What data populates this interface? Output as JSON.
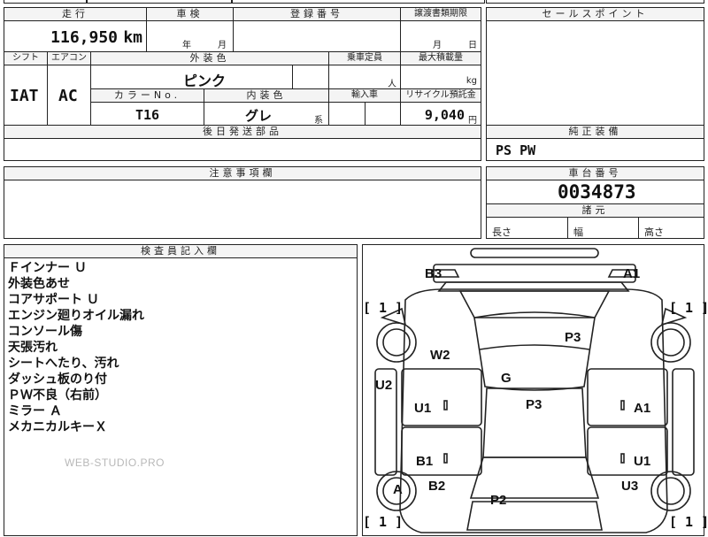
{
  "top_row": {
    "mileage_header": "走行",
    "mileage_value": "116,950",
    "mileage_unit": "km",
    "inspection_header": "車検",
    "inspection_year_label": "年",
    "inspection_month_label": "月",
    "registration_header": "登録番号",
    "transfer_header": "譲渡書類期限",
    "transfer_month_label": "月",
    "transfer_day_label": "日",
    "sales_point_header": "セールスポイント"
  },
  "mid_block": {
    "shift_header": "シフト",
    "shift_value": "IAT",
    "ac_header": "エアコン",
    "ac_value": "AC",
    "exterior_color_header": "外装色",
    "exterior_color_value": "ピンク",
    "capacity_header": "乗車定員",
    "capacity_unit": "人",
    "max_load_header": "最大積載量",
    "max_load_unit": "kg",
    "color_no_header": "カラーNo.",
    "color_no_value": "T16",
    "interior_color_header": "内装色",
    "interior_color_value": "グレ",
    "interior_color_suffix": "系",
    "import_header": "輸入車",
    "recycle_header": "リサイクル預託金",
    "recycle_value": "9,040",
    "recycle_unit": "円",
    "later_parts_header": "後日発送部品"
  },
  "equipment": {
    "header": "純正装備",
    "value": "PS PW"
  },
  "caution": {
    "header": "注意事項欄"
  },
  "chassis": {
    "header": "車台番号",
    "value": "0034873",
    "dims_header": "諸元",
    "length_label": "長さ",
    "width_label": "幅",
    "height_label": "高さ"
  },
  "inspector": {
    "header": "検査員記入欄",
    "notes": [
      "Ｆインナー Ｕ",
      "外装色あせ",
      "コアサポート Ｕ",
      "エンジン廻りオイル漏れ",
      "コンソール傷",
      "天張汚れ",
      "シートへたり、汚れ",
      "ダッシュ板のり付",
      "ＰＷ不良（右前）",
      "ミラー Ａ",
      "メカニカルキーＸ"
    ],
    "watermark": "WEB-STUDIO.PRO"
  },
  "diagram": {
    "labels": {
      "b3": "B3",
      "a1_top": "A1",
      "p3_top": "P3",
      "w2": "W2",
      "u2": "U2",
      "g": "G",
      "u1_left": "U1",
      "p3_mid": "P3",
      "a1_right": "A1",
      "b1": "B1",
      "u1_right": "U1",
      "a_wheel": "A",
      "b2": "B2",
      "u3": "U3",
      "p2": "P2"
    },
    "brackets": {
      "tl": "[ 1 ]",
      "tr": "[ 1 ]",
      "bl": "[ 1 ]",
      "br": "[ 1 ]"
    }
  }
}
